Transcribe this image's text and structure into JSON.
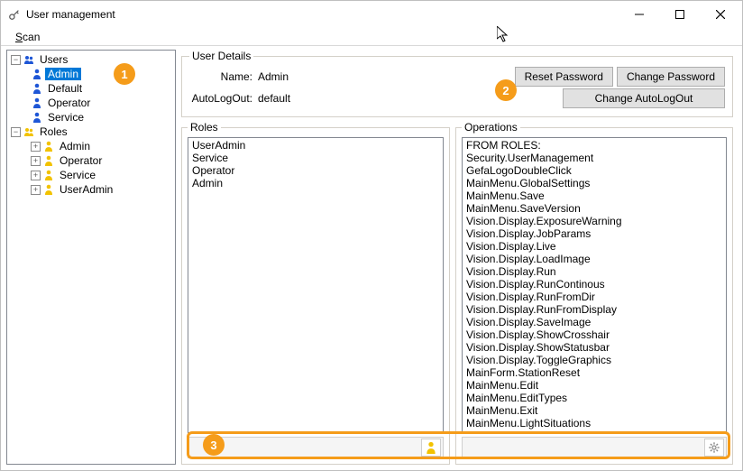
{
  "window": {
    "title": "User management"
  },
  "menubar": {
    "scan_mnemonic": "S",
    "scan_rest": "can"
  },
  "tree": {
    "users_label": "Users",
    "roles_label": "Roles",
    "users": [
      {
        "label": "Admin",
        "selected": true
      },
      {
        "label": "Default"
      },
      {
        "label": "Operator"
      },
      {
        "label": "Service"
      }
    ],
    "roles": [
      {
        "label": "Admin"
      },
      {
        "label": "Operator"
      },
      {
        "label": "Service"
      },
      {
        "label": "UserAdmin"
      }
    ]
  },
  "details": {
    "legend": "User Details",
    "name_label": "Name:",
    "name_value": "Admin",
    "autologout_label": "AutoLogOut:",
    "autologout_value": "default",
    "reset_password": "Reset Password",
    "change_password": "Change Password",
    "change_autologout": "Change AutoLogOut"
  },
  "roles": {
    "legend": "Roles",
    "items": [
      "UserAdmin",
      "Service",
      "Operator",
      "Admin"
    ]
  },
  "operations": {
    "legend": "Operations",
    "items": [
      "FROM ROLES:",
      "Security.UserManagement",
      "GefaLogoDoubleClick",
      "MainMenu.GlobalSettings",
      "MainMenu.Save",
      "MainMenu.SaveVersion",
      "Vision.Display.ExposureWarning",
      "Vision.Display.JobParams",
      "Vision.Display.Live",
      "Vision.Display.LoadImage",
      "Vision.Display.Run",
      "Vision.Display.RunContinous",
      "Vision.Display.RunFromDir",
      "Vision.Display.RunFromDisplay",
      "Vision.Display.SaveImage",
      "Vision.Display.ShowCrosshair",
      "Vision.Display.ShowStatusbar",
      "Vision.Display.ToggleGraphics",
      "MainForm.StationReset",
      "MainMenu.Edit",
      "MainMenu.EditTypes",
      "MainMenu.Exit",
      "MainMenu.LightSituations"
    ]
  },
  "callouts": {
    "c1": "1",
    "c2": "2",
    "c3": "3"
  },
  "icons": {
    "user_color": "#1e56d6",
    "role_color": "#f2c200"
  }
}
